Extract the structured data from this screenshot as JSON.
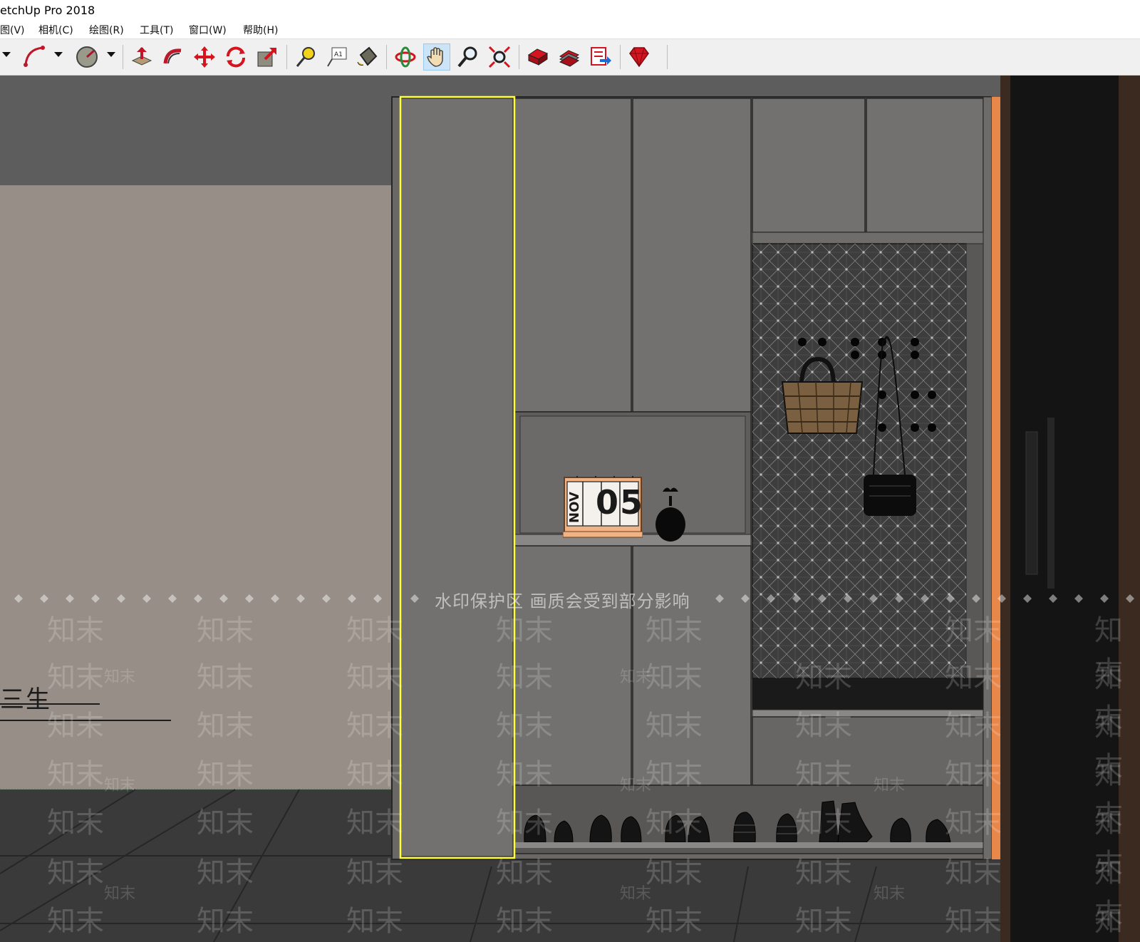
{
  "window": {
    "title": "etchUp Pro 2018"
  },
  "menu": {
    "items": [
      {
        "label": "图(V)"
      },
      {
        "label": "相机(C)"
      },
      {
        "label": "绘图(R)"
      },
      {
        "label": "工具(T)"
      },
      {
        "label": "窗口(W)"
      },
      {
        "label": "帮助(H)"
      }
    ]
  },
  "toolbar": {
    "tools": [
      "arc-icon",
      "protractor-icon",
      "push-pull-icon",
      "follow-me-icon",
      "move-icon",
      "rotate-icon",
      "scale-icon",
      "tape-measure-icon",
      "text-icon",
      "paint-bucket-icon",
      "orbit-icon",
      "pan-icon",
      "zoom-icon",
      "zoom-extents-icon",
      "warehouse-icon",
      "share-model-icon",
      "export-icon",
      "extension-icon"
    ],
    "active_tool": "pan-icon"
  },
  "scene": {
    "calendar": {
      "month": "NOV",
      "day": "05"
    },
    "wall_sign": "三生",
    "watermark_banner": "水印保护区  画质会受到部分影响",
    "watermark_glyph": "知末",
    "colors": {
      "selection": "#ffff33",
      "accent_strip": "#e8874a",
      "cabinet": "#737170",
      "wall": "#978f87"
    }
  }
}
